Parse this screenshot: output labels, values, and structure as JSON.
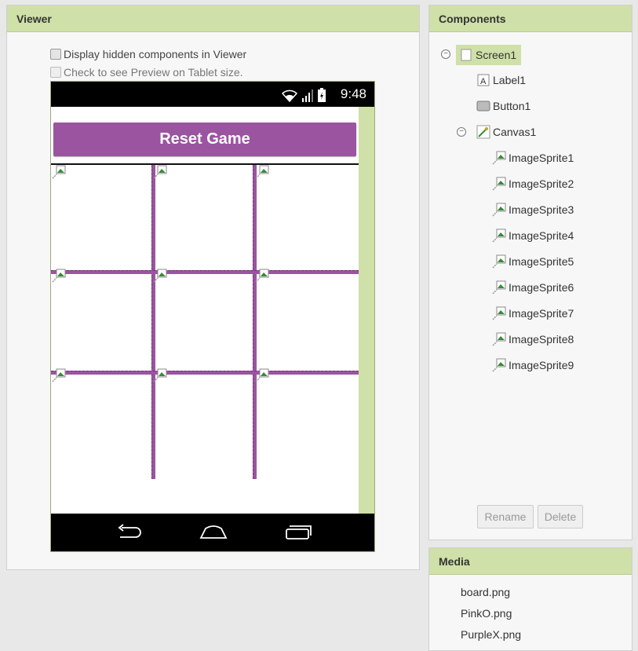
{
  "viewer": {
    "title": "Viewer",
    "show_hidden_label": "Display hidden components in Viewer",
    "tablet_preview_label": "Check to see Preview on Tablet size.",
    "phone": {
      "time": "9:48",
      "reset_button_label": "Reset Game"
    }
  },
  "components": {
    "title": "Components",
    "tree": {
      "screen": "Screen1",
      "label": "Label1",
      "button": "Button1",
      "canvas": "Canvas1",
      "sprites": [
        "ImageSprite1",
        "ImageSprite2",
        "ImageSprite3",
        "ImageSprite4",
        "ImageSprite5",
        "ImageSprite6",
        "ImageSprite7",
        "ImageSprite8",
        "ImageSprite9"
      ]
    },
    "rename_label": "Rename",
    "delete_label": "Delete"
  },
  "media": {
    "title": "Media",
    "files": [
      "board.png",
      "PinkO.png",
      "PurpleX.png"
    ]
  },
  "colors": {
    "header_green": "#cfe0a8",
    "accent_purple": "#9b54a0"
  }
}
